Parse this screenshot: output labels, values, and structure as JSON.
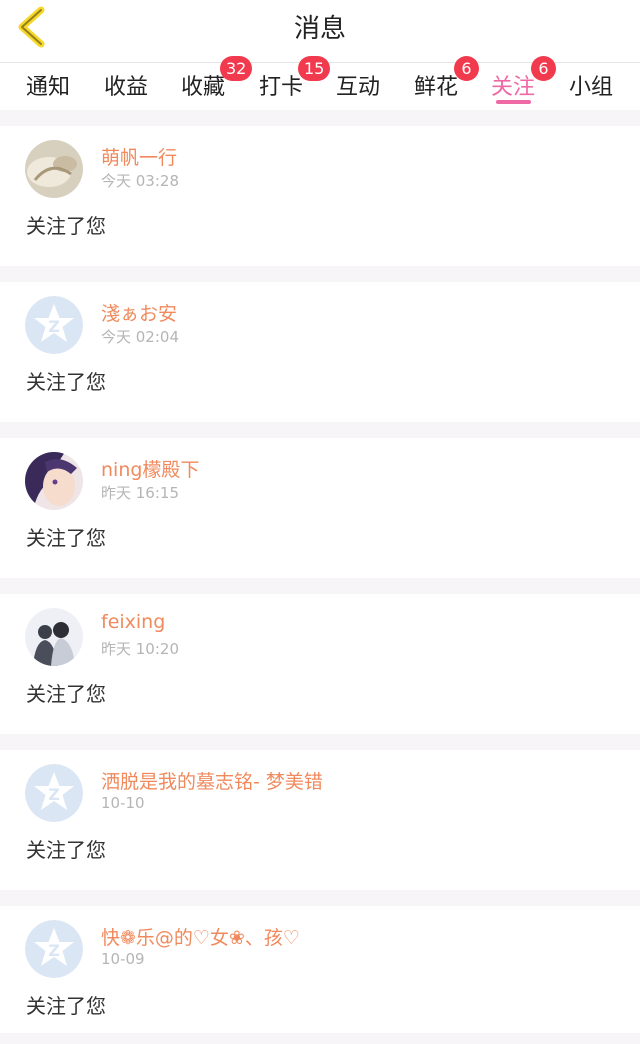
{
  "header": {
    "title": "消息",
    "back_icon": "chevron-left-icon",
    "accent": "#f6d72a"
  },
  "tabs": [
    {
      "label": "通知",
      "badge": null
    },
    {
      "label": "收益",
      "badge": null
    },
    {
      "label": "收藏",
      "badge": "32"
    },
    {
      "label": "打卡",
      "badge": "15"
    },
    {
      "label": "互动",
      "badge": null
    },
    {
      "label": "鲜花",
      "badge": "6"
    },
    {
      "label": "关注",
      "badge": "6",
      "active": true
    },
    {
      "label": "小组",
      "badge": null
    }
  ],
  "colors": {
    "active_tab": "#ef6aa4",
    "badge": "#f23a4e",
    "username": "#f08a5d"
  },
  "notifications": [
    {
      "name": "萌帆一行",
      "time": "今天 03:28",
      "action": "关注了您",
      "avatar": "photo"
    },
    {
      "name": "淺ぁお安",
      "time": "今天 02:04",
      "action": "关注了您",
      "avatar": "default"
    },
    {
      "name": "ning檬殿下",
      "time": "昨天 16:15",
      "action": "关注了您",
      "avatar": "anime"
    },
    {
      "name": "feixing",
      "time": "昨天 10:20",
      "action": "关注了您",
      "avatar": "couple"
    },
    {
      "name": "洒脱是我的墓志铭- 梦美错",
      "time": "10-10",
      "action": "关注了您",
      "avatar": "default"
    },
    {
      "name": "快❁乐@的♡女❀、孩♡",
      "time": "10-09",
      "action": "关注了您",
      "avatar": "default"
    }
  ]
}
